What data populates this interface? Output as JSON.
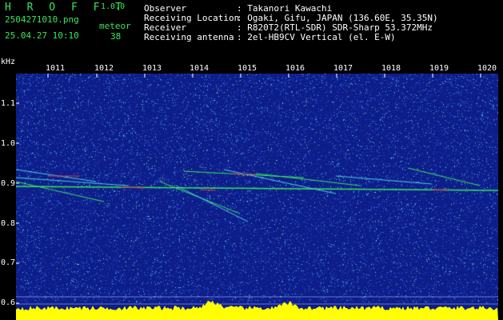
{
  "header": {
    "app_name": "H R O F F T",
    "version": "1.0.0",
    "filename": "2504271010.png",
    "datetime": "25.04.27 10:10",
    "meteor_label": "meteor",
    "meteor_count": "38"
  },
  "info": [
    {
      "label": "Observer",
      "value": ": Takanori Kawachi"
    },
    {
      "label": "Receiving Location",
      "value": ": Ogaki, Gifu, JAPAN (136.60E, 35.35N)"
    },
    {
      "label": "Receiver",
      "value": ": R820T2(RTL-SDR) SDR-Sharp 53.372MHz"
    },
    {
      "label": "Receiving antenna",
      "value": ": 2el-HB9CV Vertical (el. E-W)"
    }
  ],
  "axis": {
    "y_unit": "kHz",
    "y_ticks": [
      "1.1",
      "1.0",
      "0.9",
      "0.8",
      "0.7",
      "0.6"
    ],
    "x_ticks": [
      "1011",
      "1012",
      "1013",
      "1014",
      "1015",
      "1016",
      "1017",
      "1018",
      "1019",
      "1020"
    ]
  },
  "colors": {
    "background": "#000000",
    "waterfall_bg": "#0d1e8a",
    "trace_green": "#37e65a",
    "trace_cyan": "#4fd0e0",
    "trace_red": "#e0304a",
    "signal_yellow": "#ffff00"
  }
}
